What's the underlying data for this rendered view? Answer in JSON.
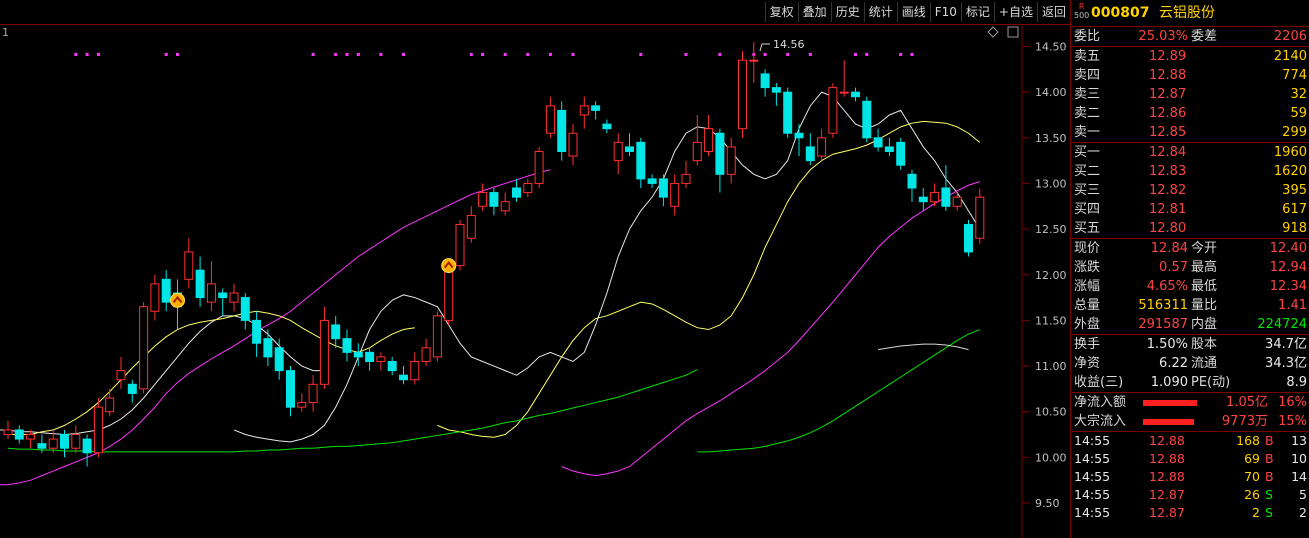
{
  "toolbar": [
    "复权",
    "叠加",
    "历史",
    "统计",
    "画线",
    "F10",
    "标记",
    "+自选",
    "返回"
  ],
  "chart": {
    "pane_index": "1",
    "high_label": "14.56",
    "y_ticks": [
      "14.50",
      "14.00",
      "13.50",
      "13.00",
      "12.50",
      "12.00",
      "11.50",
      "11.00",
      "10.50",
      "10.00",
      "9.50"
    ]
  },
  "stock": {
    "badge_top": "R",
    "badge_bottom": "500",
    "code": "000807",
    "name": "云铝股份"
  },
  "order_ratio": {
    "l1": "委比",
    "v1": "25.03%",
    "l2": "委差",
    "v2": "2206"
  },
  "asks": [
    {
      "label": "卖五",
      "price": "12.89",
      "vol": "2140"
    },
    {
      "label": "卖四",
      "price": "12.88",
      "vol": "774"
    },
    {
      "label": "卖三",
      "price": "12.87",
      "vol": "32"
    },
    {
      "label": "卖二",
      "price": "12.86",
      "vol": "59"
    },
    {
      "label": "卖一",
      "price": "12.85",
      "vol": "299"
    }
  ],
  "bids": [
    {
      "label": "买一",
      "price": "12.84",
      "vol": "1960"
    },
    {
      "label": "买二",
      "price": "12.83",
      "vol": "1620"
    },
    {
      "label": "买三",
      "price": "12.82",
      "vol": "395"
    },
    {
      "label": "买四",
      "price": "12.81",
      "vol": "617"
    },
    {
      "label": "买五",
      "price": "12.80",
      "vol": "918"
    }
  ],
  "quote": [
    {
      "l1": "现价",
      "v1": "12.84",
      "l2": "今开",
      "v2": "12.40",
      "c1": "red",
      "c2": "red"
    },
    {
      "l1": "涨跌",
      "v1": "0.57",
      "l2": "最高",
      "v2": "12.94",
      "c1": "red",
      "c2": "red"
    },
    {
      "l1": "涨幅",
      "v1": "4.65%",
      "l2": "最低",
      "v2": "12.34",
      "c1": "red",
      "c2": "red"
    },
    {
      "l1": "总量",
      "v1": "516311",
      "l2": "量比",
      "v2": "1.41",
      "c1": "yel",
      "c2": "red"
    },
    {
      "l1": "外盘",
      "v1": "291587",
      "l2": "内盘",
      "v2": "224724",
      "c1": "red",
      "c2": "grn"
    }
  ],
  "fund": [
    {
      "l1": "换手",
      "v1": "1.50%",
      "l2": "股本",
      "v2": "34.7亿"
    },
    {
      "l1": "净资",
      "v1": "6.22",
      "l2": "流通",
      "v2": "34.3亿"
    },
    {
      "l1": "收益(三)",
      "v1": "1.090",
      "l2": "PE(动)",
      "v2": "8.9"
    }
  ],
  "flow": [
    {
      "label": "净流入额",
      "value": "1.05亿",
      "pct": "16%",
      "bar": 0.16
    },
    {
      "label": "大宗流入",
      "value": "9773万",
      "pct": "15%",
      "bar": 0.15
    }
  ],
  "ticks": [
    {
      "time": "14:55",
      "price": "12.88",
      "vol": "168",
      "side": "B",
      "num": "13"
    },
    {
      "time": "14:55",
      "price": "12.88",
      "vol": "69",
      "side": "B",
      "num": "10"
    },
    {
      "time": "14:55",
      "price": "12.88",
      "vol": "70",
      "side": "B",
      "num": "14"
    },
    {
      "time": "14:55",
      "price": "12.87",
      "vol": "26",
      "side": "S",
      "num": "5"
    },
    {
      "time": "14:55",
      "price": "12.87",
      "vol": "2",
      "side": "S",
      "num": "2"
    }
  ],
  "colors": {
    "up": "#ff3030",
    "down": "#00e5e5",
    "ma5": "#e8e8e8",
    "ma10": "#ffff66",
    "ma20": "#ff33ff",
    "ma60": "#00e400",
    "bg": "#000000",
    "grid": "#7a0000"
  },
  "chart_data": {
    "type": "candlestick",
    "ylim": [
      9.3,
      14.7
    ],
    "candles": [
      [
        10.25,
        10.3,
        10.4,
        10.2
      ],
      [
        10.3,
        10.2,
        10.35,
        10.15
      ],
      [
        10.2,
        10.25,
        10.3,
        10.1
      ],
      [
        10.15,
        10.1,
        10.25,
        10.05
      ],
      [
        10.1,
        10.2,
        10.3,
        10.05
      ],
      [
        10.25,
        10.1,
        10.3,
        10.0
      ],
      [
        10.1,
        10.25,
        10.35,
        10.05
      ],
      [
        10.2,
        10.05,
        10.25,
        9.9
      ],
      [
        10.05,
        10.55,
        10.65,
        10.0
      ],
      [
        10.5,
        10.65,
        10.75,
        10.45
      ],
      [
        10.85,
        10.95,
        11.1,
        10.75
      ],
      [
        10.8,
        10.7,
        10.85,
        10.6
      ],
      [
        10.75,
        11.65,
        11.7,
        10.7
      ],
      [
        11.6,
        11.9,
        12.0,
        11.5
      ],
      [
        11.95,
        11.7,
        12.05,
        11.6
      ],
      [
        11.8,
        11.65,
        11.95,
        11.4
      ],
      [
        11.95,
        12.25,
        12.4,
        11.85
      ],
      [
        12.05,
        11.75,
        12.2,
        11.65
      ],
      [
        11.7,
        11.9,
        12.15,
        11.6
      ],
      [
        11.8,
        11.75,
        11.85,
        11.55
      ],
      [
        11.7,
        11.8,
        11.9,
        11.6
      ],
      [
        11.75,
        11.5,
        11.8,
        11.4
      ],
      [
        11.5,
        11.25,
        11.6,
        11.1
      ],
      [
        11.3,
        11.1,
        11.4,
        11.0
      ],
      [
        11.2,
        10.95,
        11.3,
        10.85
      ],
      [
        10.95,
        10.55,
        11.0,
        10.45
      ],
      [
        10.55,
        10.6,
        10.7,
        10.5
      ],
      [
        10.6,
        10.8,
        10.9,
        10.5
      ],
      [
        10.8,
        11.5,
        11.65,
        10.75
      ],
      [
        11.45,
        11.3,
        11.55,
        11.2
      ],
      [
        11.3,
        11.15,
        11.4,
        11.05
      ],
      [
        11.15,
        11.1,
        11.25,
        11.0
      ],
      [
        11.15,
        11.05,
        11.2,
        10.95
      ],
      [
        11.05,
        11.1,
        11.15,
        10.95
      ],
      [
        11.05,
        10.95,
        11.1,
        10.9
      ],
      [
        10.9,
        10.85,
        11.0,
        10.8
      ],
      [
        10.85,
        11.05,
        11.15,
        10.8
      ],
      [
        11.05,
        11.2,
        11.3,
        11.0
      ],
      [
        11.1,
        11.55,
        11.6,
        11.05
      ],
      [
        11.5,
        12.05,
        12.1,
        11.45
      ],
      [
        12.1,
        12.55,
        12.6,
        12.05
      ],
      [
        12.4,
        12.65,
        12.75,
        12.35
      ],
      [
        12.75,
        12.9,
        13.0,
        12.7
      ],
      [
        12.9,
        12.75,
        12.95,
        12.65
      ],
      [
        12.7,
        12.8,
        12.9,
        12.65
      ],
      [
        12.95,
        12.85,
        13.05,
        12.8
      ],
      [
        12.9,
        13.0,
        13.05,
        12.85
      ],
      [
        13.0,
        13.35,
        13.4,
        12.95
      ],
      [
        13.55,
        13.85,
        13.95,
        13.5
      ],
      [
        13.8,
        13.35,
        13.9,
        13.25
      ],
      [
        13.3,
        13.55,
        13.65,
        13.2
      ],
      [
        13.75,
        13.85,
        13.95,
        13.6
      ],
      [
        13.85,
        13.8,
        13.9,
        13.7
      ],
      [
        13.65,
        13.6,
        13.7,
        13.55
      ],
      [
        13.25,
        13.45,
        13.55,
        13.1
      ],
      [
        13.4,
        13.35,
        13.55,
        13.3
      ],
      [
        13.45,
        13.05,
        13.5,
        12.95
      ],
      [
        13.05,
        13.0,
        13.1,
        12.95
      ],
      [
        13.05,
        12.85,
        13.1,
        12.75
      ],
      [
        12.75,
        13.0,
        13.1,
        12.65
      ],
      [
        13.0,
        13.1,
        13.25,
        12.95
      ],
      [
        13.25,
        13.45,
        13.75,
        13.2
      ],
      [
        13.35,
        13.6,
        13.75,
        13.3
      ],
      [
        13.55,
        13.1,
        13.6,
        12.9
      ],
      [
        13.1,
        13.4,
        13.5,
        13.0
      ],
      [
        13.6,
        14.35,
        14.45,
        13.5
      ],
      [
        14.35,
        14.35,
        14.55,
        14.1
      ],
      [
        14.2,
        14.05,
        14.25,
        13.95
      ],
      [
        14.05,
        14.0,
        14.1,
        13.85
      ],
      [
        14.0,
        13.55,
        14.05,
        13.5
      ],
      [
        13.55,
        13.5,
        13.65,
        13.3
      ],
      [
        13.4,
        13.25,
        13.55,
        13.2
      ],
      [
        13.3,
        13.5,
        13.6,
        13.25
      ],
      [
        13.55,
        14.05,
        14.1,
        13.5
      ],
      [
        14.0,
        14.0,
        14.35,
        13.95
      ],
      [
        14.0,
        13.95,
        14.05,
        13.9
      ],
      [
        13.9,
        13.5,
        13.95,
        13.45
      ],
      [
        13.5,
        13.4,
        13.6,
        13.35
      ],
      [
        13.4,
        13.35,
        13.5,
        13.3
      ],
      [
        13.45,
        13.2,
        13.5,
        13.15
      ],
      [
        13.1,
        12.95,
        13.15,
        12.8
      ],
      [
        12.85,
        12.8,
        12.95,
        12.7
      ],
      [
        12.8,
        12.9,
        13.0,
        12.75
      ],
      [
        12.95,
        12.75,
        13.2,
        12.7
      ],
      [
        12.75,
        12.85,
        12.9,
        12.7
      ],
      [
        12.55,
        12.25,
        12.6,
        12.2
      ],
      [
        12.4,
        12.85,
        12.94,
        12.34
      ]
    ],
    "ma5": [
      10.3,
      10.25,
      10.22,
      10.2,
      10.18,
      10.17,
      10.2,
      10.25,
      10.35,
      10.55,
      10.8,
      11.1,
      11.4,
      11.6,
      11.72,
      11.78,
      11.75,
      11.7,
      11.65,
      11.45,
      11.25,
      11.1,
      11.05,
      11.0,
      10.95,
      10.9,
      10.98,
      11.1,
      11.15,
      11.1,
      11.05,
      11.15,
      11.45,
      11.8,
      12.2,
      12.5,
      12.7,
      12.85,
      13.05,
      13.35,
      13.55,
      13.62,
      13.6,
      13.5,
      13.35,
      13.2,
      13.1,
      13.05,
      13.1,
      13.25,
      13.6,
      13.85,
      14.0,
      13.95,
      13.8,
      13.65,
      13.6,
      13.65,
      13.75,
      13.8,
      13.6,
      13.4,
      13.25,
      13.05,
      12.9,
      12.7,
      12.5
    ],
    "ma10": [
      10.35,
      10.3,
      10.28,
      10.25,
      10.23,
      10.22,
      10.25,
      10.35,
      10.5,
      10.7,
      10.9,
      11.1,
      11.28,
      11.42,
      11.52,
      11.55,
      11.6,
      11.65,
      11.7,
      11.68,
      11.62,
      11.55,
      11.48,
      11.42,
      11.4,
      11.45,
      11.55,
      11.75,
      12.0,
      12.3,
      12.55,
      12.8,
      13.0,
      13.15,
      13.25,
      13.32,
      13.35,
      13.38,
      13.42,
      13.48,
      13.55,
      13.62,
      13.66,
      13.68,
      13.67,
      13.66,
      13.62,
      13.55,
      13.45
    ],
    "ma20": [
      9.9,
      9.85,
      9.82,
      9.8,
      9.82,
      9.85,
      9.9,
      10.0,
      10.1,
      10.2,
      10.3,
      10.4,
      10.48,
      10.55,
      10.62,
      10.7,
      10.78,
      10.86,
      10.95,
      11.05,
      11.15,
      11.28,
      11.42,
      11.56,
      11.7,
      11.85,
      12.0,
      12.15,
      12.3,
      12.42,
      12.52,
      12.62,
      12.7,
      12.78,
      12.85,
      12.92,
      12.98,
      13.02
    ],
    "ma60": [
      10.06,
      10.06,
      10.07,
      10.08,
      10.09,
      10.1,
      10.12,
      10.15,
      10.18,
      10.22,
      10.27,
      10.33,
      10.4,
      10.48,
      10.56,
      10.64,
      10.72,
      10.8,
      10.88,
      10.96,
      11.04,
      11.12,
      11.2,
      11.28,
      11.35,
      11.4
    ],
    "ma_flat": [
      11.18,
      11.2,
      11.22,
      11.23,
      11.24,
      11.24,
      11.23,
      11.21,
      11.18
    ],
    "flags": [
      {
        "i": 15,
        "y": 11.72
      },
      {
        "i": 39,
        "y": 12.1
      }
    ],
    "markers": [
      6,
      7,
      8,
      14,
      15,
      27,
      29,
      30,
      31,
      33,
      35,
      41,
      42,
      44,
      46,
      48,
      50,
      56,
      60,
      63,
      66,
      67,
      69,
      71,
      75,
      76,
      79,
      80
    ]
  }
}
